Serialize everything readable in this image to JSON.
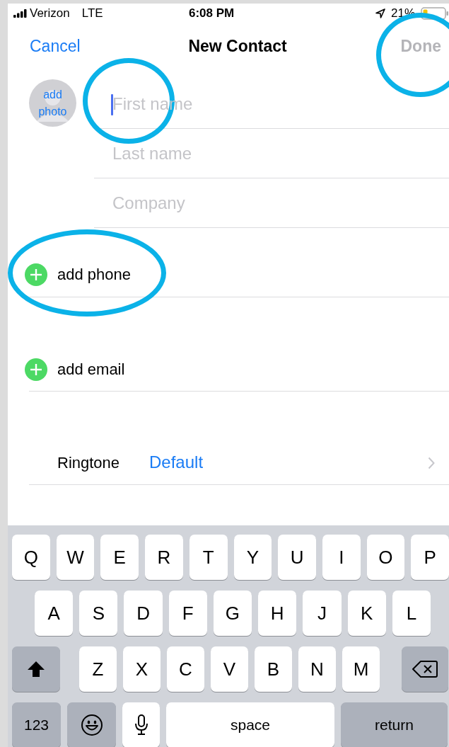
{
  "status_bar": {
    "carrier": "Verizon",
    "network": "LTE",
    "time": "6:08 PM",
    "battery": "21%"
  },
  "nav": {
    "cancel": "Cancel",
    "title": "New Contact",
    "done": {
      "label": "Done",
      "disabled": true,
      "circled": true
    }
  },
  "photo_button": "add photo",
  "name_fields": [
    {
      "placeholder": "First name",
      "focused": true,
      "circled": true
    },
    {
      "placeholder": "Last name",
      "focused": false,
      "circled": false
    },
    {
      "placeholder": "Company",
      "focused": false,
      "circled": false
    }
  ],
  "add_rows": [
    {
      "label": "add phone",
      "circled": true
    },
    {
      "label": "add email",
      "circled": false
    }
  ],
  "ringtone": {
    "label": "Ringtone",
    "value": "Default"
  },
  "keyboard": {
    "rows": [
      [
        {
          "kind": "letter",
          "label": "Q"
        },
        {
          "kind": "letter",
          "label": "W"
        },
        {
          "kind": "letter",
          "label": "E"
        },
        {
          "kind": "letter",
          "label": "R"
        },
        {
          "kind": "letter",
          "label": "T"
        },
        {
          "kind": "letter",
          "label": "Y"
        },
        {
          "kind": "letter",
          "label": "U"
        },
        {
          "kind": "letter",
          "label": "I"
        },
        {
          "kind": "letter",
          "label": "O"
        },
        {
          "kind": "letter",
          "label": "P"
        }
      ],
      [
        {
          "kind": "letter",
          "label": "A"
        },
        {
          "kind": "letter",
          "label": "S"
        },
        {
          "kind": "letter",
          "label": "D"
        },
        {
          "kind": "letter",
          "label": "F"
        },
        {
          "kind": "letter",
          "label": "G"
        },
        {
          "kind": "letter",
          "label": "H"
        },
        {
          "kind": "letter",
          "label": "J"
        },
        {
          "kind": "letter",
          "label": "K"
        },
        {
          "kind": "letter",
          "label": "L"
        }
      ],
      [
        {
          "kind": "shift"
        },
        {
          "kind": "letter",
          "label": "Z"
        },
        {
          "kind": "letter",
          "label": "X"
        },
        {
          "kind": "letter",
          "label": "C"
        },
        {
          "kind": "letter",
          "label": "V"
        },
        {
          "kind": "letter",
          "label": "B"
        },
        {
          "kind": "letter",
          "label": "N"
        },
        {
          "kind": "letter",
          "label": "M"
        },
        {
          "kind": "delete"
        }
      ],
      [
        {
          "kind": "numbers",
          "label": "123"
        },
        {
          "kind": "emoji"
        },
        {
          "kind": "mic"
        },
        {
          "kind": "space",
          "label": "space"
        },
        {
          "kind": "return",
          "label": "return"
        }
      ]
    ]
  }
}
